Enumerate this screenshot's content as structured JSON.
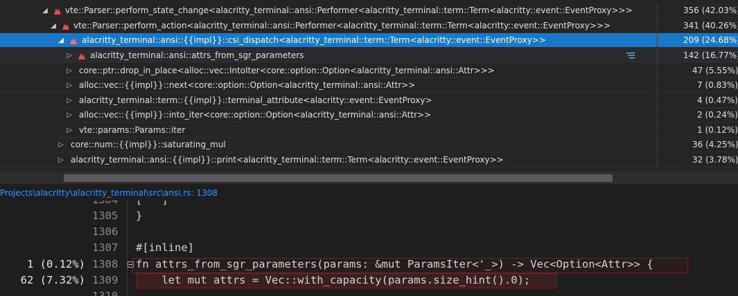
{
  "call_tree": {
    "rows": [
      {
        "name": "vte::Parser::perform_state_change<alacritty_terminal::ansi::Performer<alacritty_terminal::term::Term<alacritty::event::EventProxy>>>",
        "cost": "356 (42.03%)",
        "expanded": true,
        "hot": true
      },
      {
        "name": "vte::Parser::perform_action<alacritty_terminal::ansi::Performer<alacritty_terminal::term::Term<alacritty::event::EventProxy>>>",
        "cost": "341 (40.26%)",
        "expanded": true,
        "hot": true
      },
      {
        "name": "alacritty_terminal::ansi::{{impl}}::csi_dispatch<alacritty_terminal::term::Term<alacritty::event::EventProxy>>",
        "cost": "209 (24.68%)",
        "expanded": true,
        "hot": true,
        "selected": true
      },
      {
        "name": "alacritty_terminal::ansi::attrs_from_sgr_parameters",
        "cost": "142 (16.77%)",
        "expanded": false,
        "hot": true,
        "hover": true
      },
      {
        "name": "core::ptr::drop_in_place<alloc::vec::IntoIter<core::option::Option<alacritty_terminal::ansi::Attr>>>",
        "cost": "47 (5.55%)",
        "expanded": false,
        "hot": false
      },
      {
        "name": "alloc::vec::{{impl}}::next<core::option::Option<alacritty_terminal::ansi::Attr>>",
        "cost": "7 (0.83%)",
        "expanded": false,
        "hot": false
      },
      {
        "name": "alacritty_terminal::term::{{impl}}::terminal_attribute<alacritty::event::EventProxy>",
        "cost": "4 (0.47%)",
        "expanded": false,
        "hot": false
      },
      {
        "name": "alloc::vec::{{impl}}::into_iter<core::option::Option<alacritty_terminal::ansi::Attr>>",
        "cost": "2 (0.24%)",
        "expanded": false,
        "hot": false
      },
      {
        "name": "vte::params::Params::iter",
        "cost": "1 (0.12%)",
        "expanded": false,
        "hot": false
      },
      {
        "name": "core::num::{{impl}}::saturating_mul",
        "cost": "36 (4.25%)",
        "expanded": false,
        "hot": false
      },
      {
        "name": "alacritty_terminal::ansi::{{impl}}::print<alacritty_terminal::term::Term<alacritty::event::EventProxy>>",
        "cost": "32 (3.78%)",
        "expanded": false,
        "hot": false
      }
    ]
  },
  "source": {
    "path": "Projects\\alacritty\\alacritty_terminal\\src\\ansi.rs: 1308",
    "lines": [
      {
        "no": "1305",
        "hits": "",
        "code": "}"
      },
      {
        "no": "1306",
        "hits": "",
        "code": ""
      },
      {
        "no": "1307",
        "hits": "",
        "code": "#[inline]"
      },
      {
        "no": "1308",
        "hits": "1 (0.12%)",
        "code": "fn attrs_from_sgr_parameters(params: &mut ParamsIter<'_>) -> Vec<Option<Attr>> {"
      },
      {
        "no": "1309",
        "hits": "62 (7.32%)",
        "code": "    let mut attrs = Vec::with_capacity(params.size_hint().0);"
      }
    ]
  },
  "colors": {
    "selected_row": "#1978c8",
    "hot_flame": "#e05050",
    "link": "#3794ff"
  }
}
